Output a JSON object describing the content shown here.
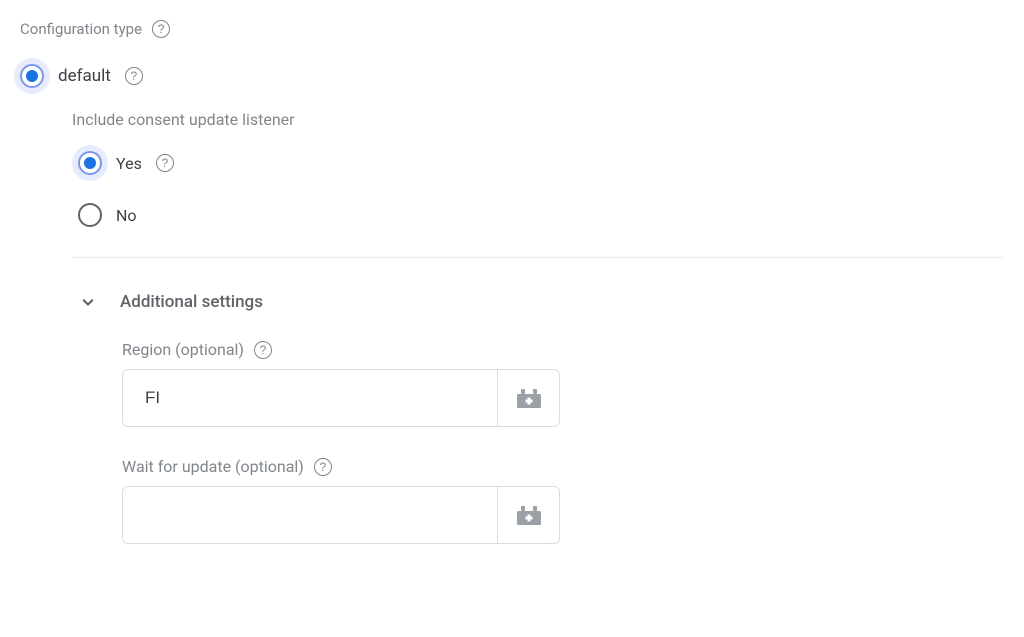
{
  "configType": {
    "label": "Configuration type",
    "selected": "default"
  },
  "options": {
    "default": {
      "label": "default"
    }
  },
  "consentListener": {
    "label": "Include consent update listener",
    "selected": "yes",
    "yes": "Yes",
    "no": "No"
  },
  "additional": {
    "title": "Additional settings",
    "region": {
      "label": "Region (optional)",
      "value": "FI"
    },
    "waitForUpdate": {
      "label": "Wait for update (optional)",
      "value": ""
    }
  }
}
